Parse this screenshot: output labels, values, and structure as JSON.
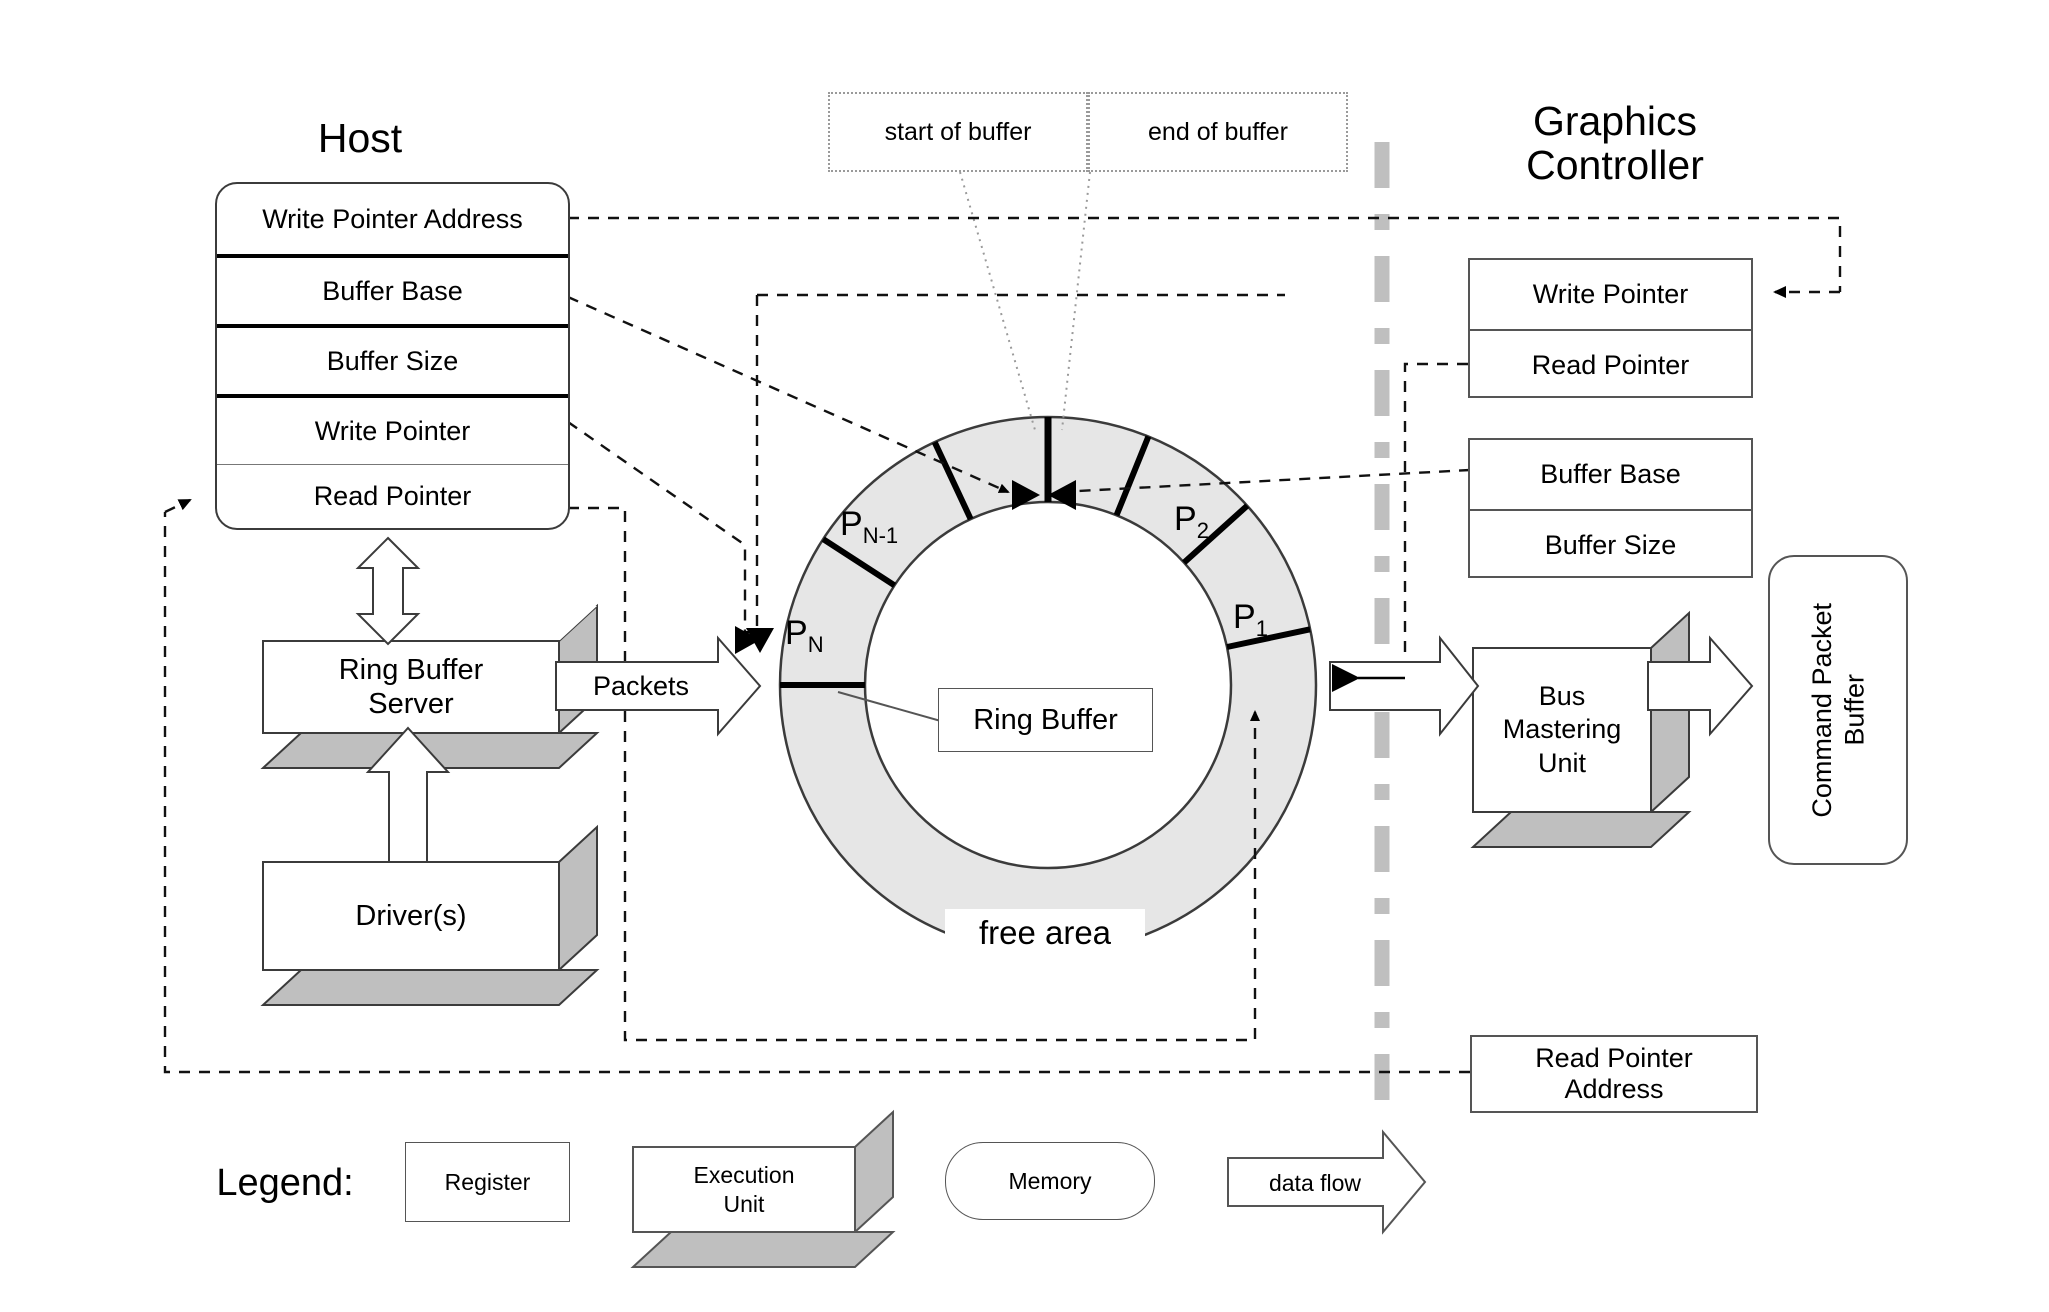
{
  "diagram": {
    "host": {
      "title": "Host",
      "registers": [
        {
          "label": "Write Pointer Address"
        },
        {
          "label": "Buffer Base"
        },
        {
          "label": "Buffer Size"
        },
        {
          "label": "Write Pointer"
        },
        {
          "label": "Read Pointer"
        }
      ],
      "units": [
        {
          "label": "Ring Buffer\nServer"
        },
        {
          "label": "Driver(s)"
        }
      ],
      "flows": [
        {
          "label": "Packets"
        }
      ]
    },
    "graphics_controller": {
      "title": "Graphics\nController",
      "pointer_registers": [
        {
          "label": "Write Pointer"
        },
        {
          "label": "Read Pointer"
        }
      ],
      "buffer_registers": [
        {
          "label": "Buffer Base"
        },
        {
          "label": "Buffer Size"
        }
      ],
      "read_pointer_address": {
        "label": "Read Pointer\nAddress"
      },
      "units": [
        {
          "label": "Bus\nMastering\nUnit"
        }
      ],
      "memories": [
        {
          "label": "Command Packet\nBuffer"
        }
      ]
    },
    "ring": {
      "center_label": "Ring Buffer",
      "free_label": "free area",
      "packets": [
        {
          "id": "p1",
          "base": "P",
          "sub": "1"
        },
        {
          "id": "p2",
          "base": "P",
          "sub": "2"
        },
        {
          "id": "pn_1",
          "base": "P",
          "sub": "N-1"
        },
        {
          "id": "pn",
          "base": "P",
          "sub": "N"
        }
      ],
      "callouts": [
        {
          "label": "start of buffer"
        },
        {
          "label": "end of buffer"
        }
      ]
    },
    "legend": {
      "title": "Legend:",
      "items": [
        {
          "label": "Register",
          "shape": "rectangle"
        },
        {
          "label": "Execution\nUnit",
          "shape": "cube"
        },
        {
          "label": "Memory",
          "shape": "rounded"
        },
        {
          "label": "data flow",
          "shape": "block-arrow"
        }
      ]
    },
    "colors": {
      "ring_fill": "#e6e6e6",
      "cube_side": "#bfbfbf",
      "divider": "#bfbfbf",
      "stroke": "#3b3b3b",
      "background": "#ffffff"
    }
  }
}
